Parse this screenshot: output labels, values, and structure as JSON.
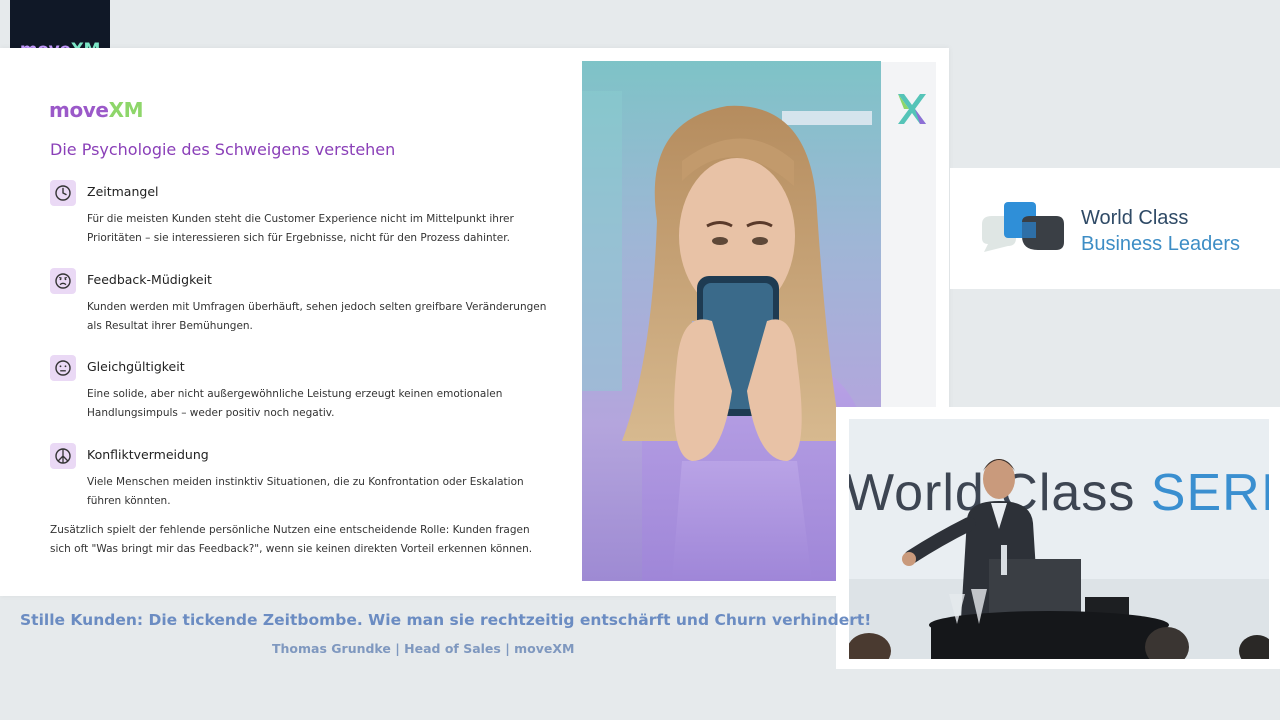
{
  "brand": {
    "logo_part1": "move",
    "logo_part2": "XM"
  },
  "slide": {
    "logo_part1": "move",
    "logo_part2": "XM",
    "title": "Die Psychologie des Schweigens verstehen",
    "items": [
      {
        "icon": "clock-icon",
        "heading": "Zeitmangel",
        "text": "Für die meisten Kunden steht die Customer Experience nicht im Mittelpunkt ihrer Prioritäten – sie interessieren sich für Ergebnisse, nicht für den Prozess dahinter."
      },
      {
        "icon": "frown-face-icon",
        "heading": "Feedback-Müdigkeit",
        "text": "Kunden werden mit Umfragen überhäuft, sehen jedoch selten greifbare Veränderungen als Resultat ihrer Bemühungen."
      },
      {
        "icon": "neutral-face-icon",
        "heading": "Gleichgültigkeit",
        "text": "Eine solide, aber nicht außergewöhnliche Leistung erzeugt keinen emotionalen Handlungsimpuls – weder positiv noch negativ."
      },
      {
        "icon": "peace-icon",
        "heading": "Konfliktvermeidung",
        "text": "Viele Menschen meiden instinktiv Situationen, die zu Konfrontation oder Eskalation führen könnten."
      }
    ],
    "closing": "Zusätzlich spielt der fehlende persönliche Nutzen eine entscheidende Rolle: Kunden fragen sich oft \"Was bringt mir das Feedback?\", wenn sie keinen direkten Vorteil erkennen können."
  },
  "partner": {
    "line1": "World Class",
    "line2": "Business Leaders"
  },
  "video": {
    "banner_part1": "World Class ",
    "banner_part2": "SERI"
  },
  "caption": {
    "title": "Stille Kunden: Die tickende Zeitbombe. Wie man sie rechtzeitig entschärft und Churn verhindert!",
    "subtitle": "Thomas Grundke | Head of Sales | moveXM"
  },
  "colors": {
    "accent_purple": "#8a3fb8",
    "caption_blue": "#6b8cc2",
    "brand_dark": "#101827"
  }
}
